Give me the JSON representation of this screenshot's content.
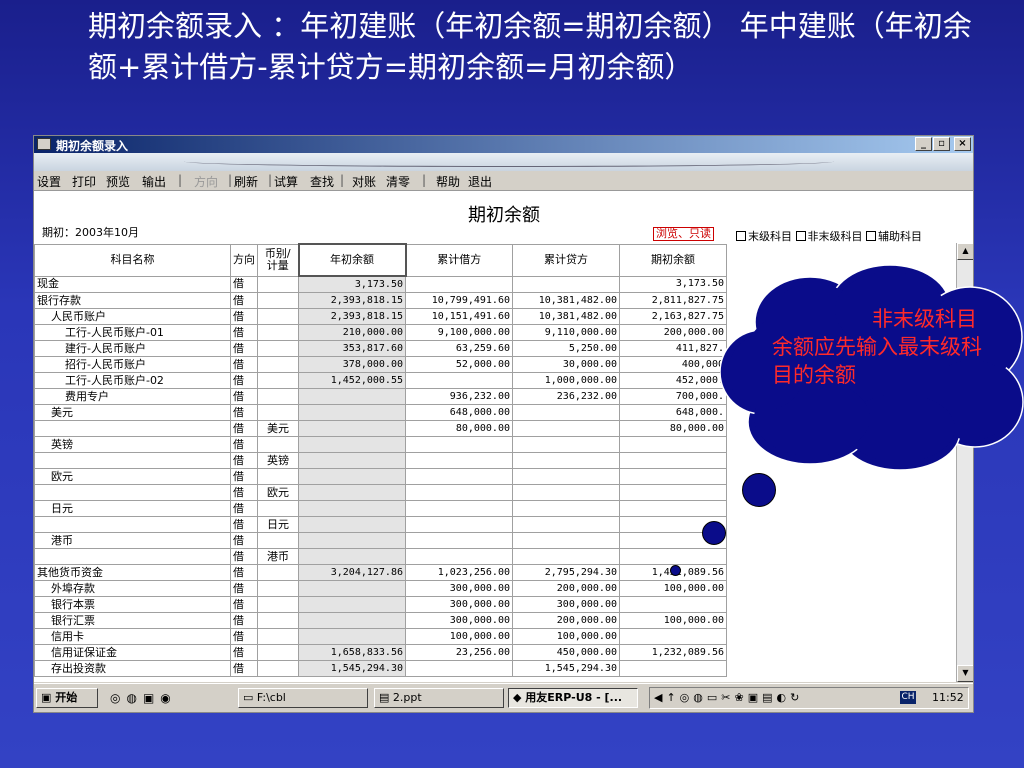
{
  "slide": {
    "title": "期初余额录入  ：年初建账（年初余额=期初余额） 年中建账（年初余额+累计借方-累计贷方=期初余额=月初余额）"
  },
  "window": {
    "title": "期初余额录入",
    "min": "_",
    "max": "▫",
    "close": "×"
  },
  "menu": [
    "设置",
    "打印",
    "预览",
    "输出",
    "|",
    "方向",
    "|",
    "刷新",
    "|",
    "试算",
    "查找",
    "|",
    "对账",
    "清零",
    "|",
    "帮助",
    "退出"
  ],
  "report": {
    "title": "期初余额",
    "period": "期初：2003年10月",
    "readonly": "浏览、只读",
    "filters": [
      "末级科目",
      "非末级科目",
      "辅助科目"
    ]
  },
  "columns": [
    "科目名称",
    "方向",
    "币别/计量",
    "年初余额",
    "累计借方",
    "累计贷方",
    "期初余额"
  ],
  "rows": [
    {
      "name": "现金",
      "indent": 0,
      "dir": "借",
      "cur": "",
      "y": "3,173.50",
      "d": "",
      "c": "",
      "o": "3,173.50"
    },
    {
      "name": "银行存款",
      "indent": 0,
      "dir": "借",
      "cur": "",
      "y": "2,393,818.15",
      "d": "10,799,491.60",
      "c": "10,381,482.00",
      "o": "2,811,827.75"
    },
    {
      "name": "人民币账户",
      "indent": 1,
      "dir": "借",
      "cur": "",
      "y": "2,393,818.15",
      "d": "10,151,491.60",
      "c": "10,381,482.00",
      "o": "2,163,827.75"
    },
    {
      "name": "工行-人民币账户-01",
      "indent": 2,
      "dir": "借",
      "cur": "",
      "y": "210,000.00",
      "d": "9,100,000.00",
      "c": "9,110,000.00",
      "o": "200,000.00"
    },
    {
      "name": "建行-人民币账户",
      "indent": 2,
      "dir": "借",
      "cur": "",
      "y": "353,817.60",
      "d": "63,259.60",
      "c": "5,250.00",
      "o": "411,827."
    },
    {
      "name": "招行-人民币账户",
      "indent": 2,
      "dir": "借",
      "cur": "",
      "y": "378,000.00",
      "d": "52,000.00",
      "c": "30,000.00",
      "o": "400,000"
    },
    {
      "name": "工行-人民币账户-02",
      "indent": 2,
      "dir": "借",
      "cur": "",
      "y": "1,452,000.55",
      "d": "",
      "c": "1,000,000.00",
      "o": "452,000."
    },
    {
      "name": "费用专户",
      "indent": 2,
      "dir": "借",
      "cur": "",
      "y": "",
      "d": "936,232.00",
      "c": "236,232.00",
      "o": "700,000."
    },
    {
      "name": "美元",
      "indent": 1,
      "dir": "借",
      "cur": "",
      "y": "",
      "d": "648,000.00",
      "c": "",
      "o": "648,000."
    },
    {
      "name": "",
      "indent": 0,
      "dir": "借",
      "cur": "美元",
      "y": "",
      "d": "80,000.00",
      "c": "",
      "o": "80,000.00"
    },
    {
      "name": "英镑",
      "indent": 1,
      "dir": "借",
      "cur": "",
      "y": "",
      "d": "",
      "c": "",
      "o": ""
    },
    {
      "name": "",
      "indent": 0,
      "dir": "借",
      "cur": "英镑",
      "y": "",
      "d": "",
      "c": "",
      "o": ""
    },
    {
      "name": "欧元",
      "indent": 1,
      "dir": "借",
      "cur": "",
      "y": "",
      "d": "",
      "c": "",
      "o": ""
    },
    {
      "name": "",
      "indent": 0,
      "dir": "借",
      "cur": "欧元",
      "y": "",
      "d": "",
      "c": "",
      "o": ""
    },
    {
      "name": "日元",
      "indent": 1,
      "dir": "借",
      "cur": "",
      "y": "",
      "d": "",
      "c": "",
      "o": ""
    },
    {
      "name": "",
      "indent": 0,
      "dir": "借",
      "cur": "日元",
      "y": "",
      "d": "",
      "c": "",
      "o": ""
    },
    {
      "name": "港币",
      "indent": 1,
      "dir": "借",
      "cur": "",
      "y": "",
      "d": "",
      "c": "",
      "o": ""
    },
    {
      "name": "",
      "indent": 0,
      "dir": "借",
      "cur": "港币",
      "y": "",
      "d": "",
      "c": "",
      "o": ""
    },
    {
      "name": "其他货币资金",
      "indent": 0,
      "dir": "借",
      "cur": "",
      "y": "3,204,127.86",
      "d": "1,023,256.00",
      "c": "2,795,294.30",
      "o": "1,432,089.56"
    },
    {
      "name": "外埠存款",
      "indent": 1,
      "dir": "借",
      "cur": "",
      "y": "",
      "d": "300,000.00",
      "c": "200,000.00",
      "o": "100,000.00"
    },
    {
      "name": "银行本票",
      "indent": 1,
      "dir": "借",
      "cur": "",
      "y": "",
      "d": "300,000.00",
      "c": "300,000.00",
      "o": ""
    },
    {
      "name": "银行汇票",
      "indent": 1,
      "dir": "借",
      "cur": "",
      "y": "",
      "d": "300,000.00",
      "c": "200,000.00",
      "o": "100,000.00"
    },
    {
      "name": "信用卡",
      "indent": 1,
      "dir": "借",
      "cur": "",
      "y": "",
      "d": "100,000.00",
      "c": "100,000.00",
      "o": ""
    },
    {
      "name": "信用证保证金",
      "indent": 1,
      "dir": "借",
      "cur": "",
      "y": "1,658,833.56",
      "d": "23,256.00",
      "c": "450,000.00",
      "o": "1,232,089.56"
    },
    {
      "name": "存出投资款",
      "indent": 1,
      "dir": "借",
      "cur": "",
      "y": "1,545,294.30",
      "d": "",
      "c": "1,545,294.30",
      "o": ""
    }
  ],
  "taskbar": {
    "start": "开始",
    "folder": "F:\\cbl",
    "ppt": "2.ppt",
    "erp": "用友ERP-U8 - [...",
    "ime": "CH",
    "clock": "11:52"
  },
  "callout": {
    "text": "非末级科目余额应先输入最末级科目的余额"
  }
}
